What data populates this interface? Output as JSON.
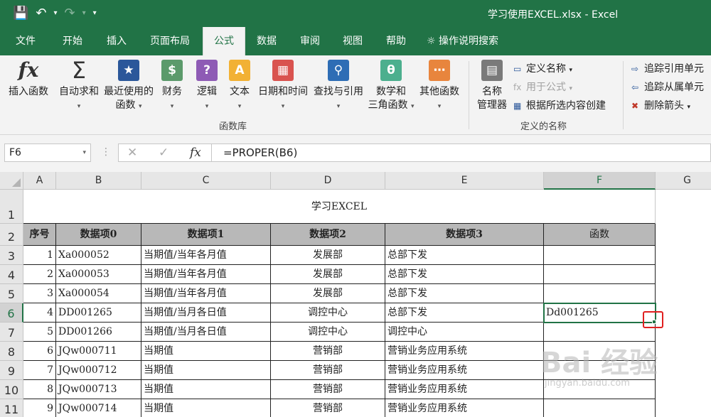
{
  "window": {
    "title": "学习使用EXCEL.xlsx  -  Excel"
  },
  "tabs": [
    "文件",
    "开始",
    "插入",
    "页面布局",
    "公式",
    "数据",
    "审阅",
    "视图",
    "帮助"
  ],
  "active_tab": "公式",
  "tell_me": "操作说明搜索",
  "ribbon": {
    "insert_function": "插入函数",
    "autosum": "自动求和",
    "recent_1": "最近使用的",
    "recent_2": "函数",
    "financial": "财务",
    "logical": "逻辑",
    "text": "文本",
    "datetime": "日期和时间",
    "lookup": "查找与引用",
    "math_1": "数学和",
    "math_2": "三角函数",
    "more": "其他函数",
    "group_library": "函数库",
    "name_manager_1": "名称",
    "name_manager_2": "管理器",
    "define_name": "定义名称",
    "use_in_formula": "用于公式",
    "create_from_selection": "根据所选内容创建",
    "group_defined_names": "定义的名称",
    "trace_precedents": "追踪引用单元",
    "trace_dependents": "追踪从属单元",
    "remove_arrows": "删除箭头"
  },
  "formula_bar": {
    "name_box": "F6",
    "formula": "=PROPER(B6)",
    "fx": "fx"
  },
  "columns": [
    "A",
    "B",
    "C",
    "D",
    "E",
    "F",
    "G"
  ],
  "rows": [
    "1",
    "2",
    "3",
    "4",
    "5",
    "6",
    "7",
    "8",
    "9",
    "10",
    "11"
  ],
  "sheet": {
    "title": "学习EXCEL",
    "headers": [
      "序号",
      "数据项0",
      "数据项1",
      "数据项2",
      "数据项3",
      "函数"
    ],
    "data": [
      [
        "1",
        "Xa000052",
        "当期值/当年各月值",
        "发展部",
        "总部下发",
        ""
      ],
      [
        "2",
        "Xa000053",
        "当期值/当年各月值",
        "发展部",
        "总部下发",
        ""
      ],
      [
        "3",
        "Xa000054",
        "当期值/当年各月值",
        "发展部",
        "总部下发",
        ""
      ],
      [
        "4",
        "DD001265",
        "当期值/当月各日值",
        "调控中心",
        "总部下发",
        "Dd001265"
      ],
      [
        "5",
        "DD001266",
        "当期值/当月各日值",
        "调控中心",
        "调控中心",
        ""
      ],
      [
        "6",
        "JQw000711",
        "当期值",
        "营销部",
        "营销业务应用系统",
        ""
      ],
      [
        "7",
        "JQw000712",
        "当期值",
        "营销部",
        "营销业务应用系统",
        ""
      ],
      [
        "8",
        "JQw000713",
        "当期值",
        "营销部",
        "营销业务应用系统",
        ""
      ],
      [
        "9",
        "JQw000714",
        "当期值",
        "营销部",
        "营销业务应用系统",
        ""
      ]
    ]
  },
  "watermark": {
    "brand": "Bai 经验",
    "url": "jingyan.baidu.com"
  }
}
